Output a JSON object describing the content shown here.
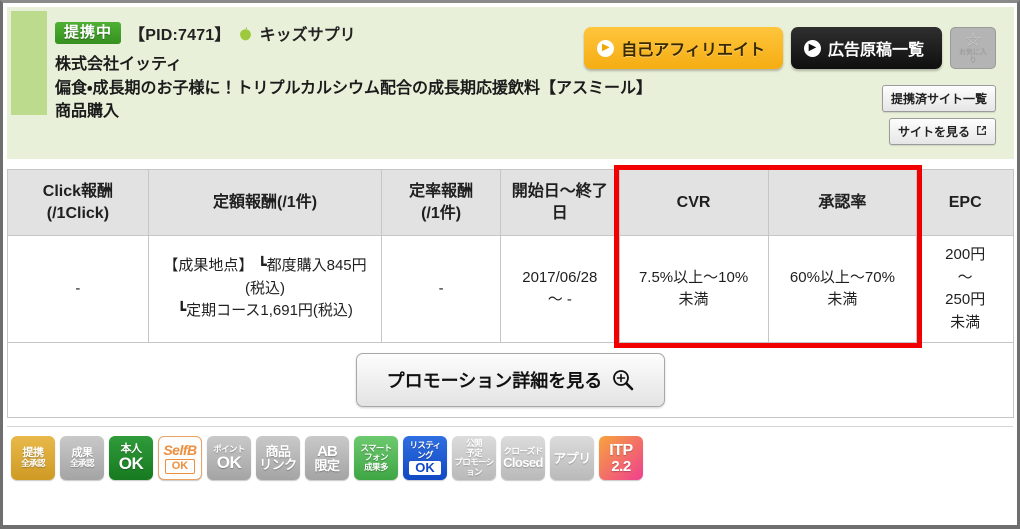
{
  "header": {
    "status_tag": "提携中",
    "pid": "【PID:7471】",
    "category_icon": "apple-icon",
    "category": "キッズサプリ",
    "company": "株式会社イッティ",
    "promo_title": "偏食・成長期のお子様に！トリプルカルシウム配合の成長期応援飲料【アスミール】 商品購入",
    "buttons": {
      "self_affiliate": "自己アフィリエイト",
      "ad_materials": "広告原稿一覧",
      "favorite_label": "お気に入り",
      "partner_sites": "提携済サイト一覧",
      "view_site": "サイトを見る"
    }
  },
  "table": {
    "headers": [
      "Click報酬\n(/1Click)",
      "定額報酬(/1件)",
      "定率報酬\n(/1件)",
      "開始日～終了日",
      "CVR",
      "承認率",
      "EPC"
    ],
    "headers_split": [
      {
        "l1": "Click報酬",
        "l2": "(/1Click)"
      },
      {
        "l1": "定額報酬(/1件)",
        "l2": ""
      },
      {
        "l1": "定率報酬",
        "l2": "(/1件)"
      },
      {
        "l1": "開始日～終了",
        "l2": "日"
      },
      {
        "l1": "CVR",
        "l2": ""
      },
      {
        "l1": "承認率",
        "l2": ""
      },
      {
        "l1": "EPC",
        "l2": ""
      }
    ],
    "row": {
      "click_reward": "-",
      "fixed_reward_l1": "【成果地点】 ┗都度購入845円(税込)",
      "fixed_reward_l2": "┗定期コース1,691円(税込)",
      "rate_reward": "-",
      "period": "2017/06/28 ～ -",
      "period_l1": "2017/06/28",
      "period_l2": "～ -",
      "cvr": "7.5%以上～10%未満",
      "cvr_l1": "7.5%以上～10%",
      "cvr_l2": "未満",
      "approval_rate": "60%以上～70%未満",
      "approval_l1": "60%以上～70%",
      "approval_l2": "未満",
      "epc": "200円 ～ 250円 未満",
      "epc_l1": "200円",
      "epc_l2": "～",
      "epc_l3": "250円",
      "epc_l4": "未満"
    },
    "highlight_color": "#f20000"
  },
  "promo_button": {
    "label": "プロモーション詳細を見る",
    "icon": "magnifier-plus-icon"
  },
  "badges": [
    {
      "name": "teikei-zenshounin",
      "top": "提携",
      "bottom": "全承認"
    },
    {
      "name": "seika-zenshounin",
      "top": "成果",
      "bottom": "全承認"
    },
    {
      "name": "honnin-ok",
      "top": "本人",
      "bottom": "OK"
    },
    {
      "name": "selfb-ok",
      "top": "SelfB",
      "bottom": "OK"
    },
    {
      "name": "point-ok",
      "top": "ポイント",
      "bottom": "OK"
    },
    {
      "name": "shouhin-link",
      "top": "商品",
      "bottom": "リンク"
    },
    {
      "name": "ab-gentei",
      "top": "AB",
      "bottom": "限定"
    },
    {
      "name": "smartphone-seikaoo",
      "top": "スマート",
      "mid": "フォン",
      "bottom": "成果多"
    },
    {
      "name": "listing-ok",
      "top": "リスティ",
      "mid": "ング",
      "bottom": "OK"
    },
    {
      "name": "koukai-yotei",
      "top": "公開",
      "mid": "予定",
      "bottom": "プロモーション"
    },
    {
      "name": "closed",
      "top": "クローズド",
      "bottom": "Closed"
    },
    {
      "name": "app",
      "top": "",
      "bottom": "アプリ"
    },
    {
      "name": "itp-22",
      "top": "ITP",
      "bottom": "2.2"
    }
  ]
}
